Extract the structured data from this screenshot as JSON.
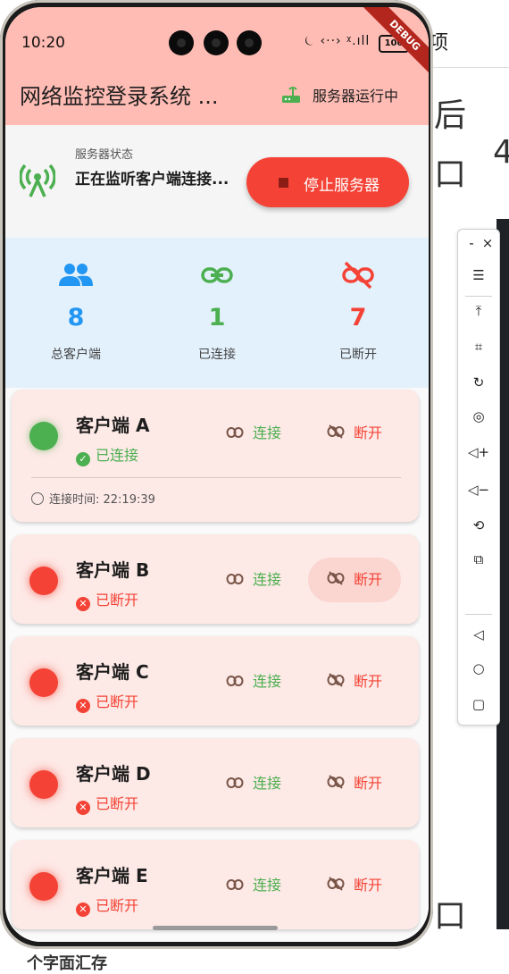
{
  "status_bar": {
    "time": "10:20",
    "battery": "100",
    "icons": "⏾ ‹··› ᵡ.ıll"
  },
  "debug_banner": "DEBUG",
  "app_bar": {
    "title": "网络监控登录系统 ...",
    "server_state": "服务器运行中"
  },
  "server_status": {
    "caption": "服务器状态",
    "message": "正在监听客户端连接...",
    "stop_button": "停止服务器"
  },
  "stats": [
    {
      "value": "8",
      "label": "总客户端",
      "color": "#2196f3",
      "icon": "people-icon"
    },
    {
      "value": "1",
      "label": "已连接",
      "color": "#4caf50",
      "icon": "link-icon"
    },
    {
      "value": "7",
      "label": "已断开",
      "color": "#f44336",
      "icon": "link-off-icon"
    }
  ],
  "clients": [
    {
      "name": "客户端 A",
      "state": "已连接",
      "connected": true,
      "connect_label": "连接",
      "disconnect_label": "断开",
      "conn_time": "连接时间: 22:19:39"
    },
    {
      "name": "客户端 B",
      "state": "已断开",
      "connected": false,
      "connect_label": "连接",
      "disconnect_label": "断开"
    },
    {
      "name": "客户端 C",
      "state": "已断开",
      "connected": false,
      "connect_label": "连接",
      "disconnect_label": "断开"
    },
    {
      "name": "客户端 D",
      "state": "已断开",
      "connected": false,
      "connect_label": "连接",
      "disconnect_label": "断开"
    },
    {
      "name": "客户端 E",
      "state": "已断开",
      "connected": false,
      "connect_label": "连接",
      "disconnect_label": "断开"
    }
  ],
  "background": {
    "tab1": "项",
    "tab2": "",
    "glyph_a": "后",
    "glyph_b": "4",
    "glyph_c": "口",
    "glyph_d": "口",
    "bottom_text": "个字面汇存"
  },
  "sidebar": {
    "tools": [
      "minimize-icon",
      "close-icon",
      "menu-icon",
      "pin-top-icon",
      "crop-icon",
      "rotate-icon",
      "record-icon",
      "volume-up-icon",
      "volume-down-icon",
      "rotate-screen-icon",
      "screenshot-icon",
      "back-icon",
      "home-icon",
      "recents-icon"
    ]
  },
  "colors": {
    "accent_red": "#f44336",
    "green": "#4caf50",
    "blue": "#2196f3",
    "appbar": "#ffbcb4"
  }
}
